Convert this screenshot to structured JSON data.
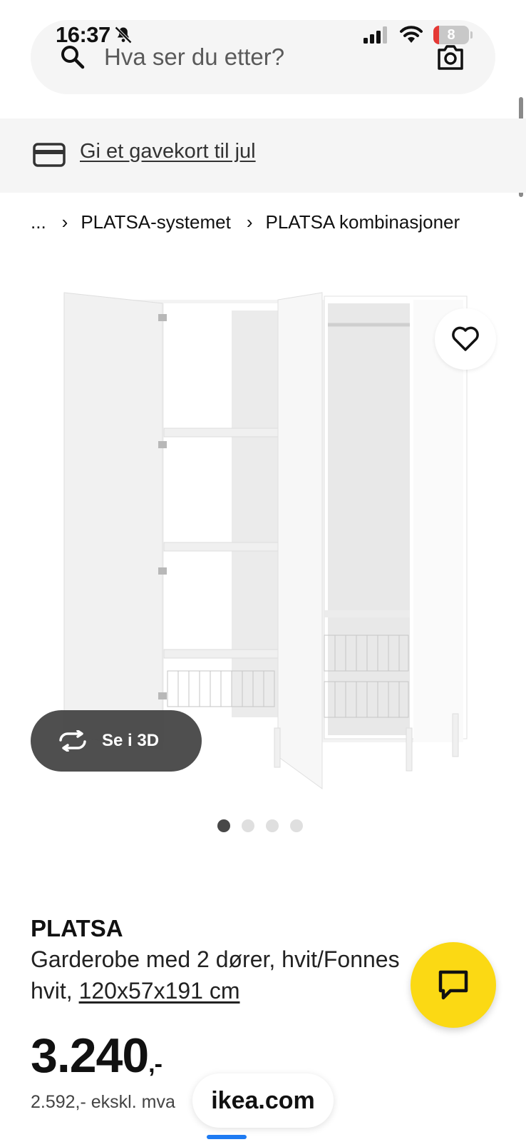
{
  "status_bar": {
    "time": "16:37",
    "battery": "8",
    "icons": [
      "bell-slash-icon",
      "signal-icon",
      "wifi-icon",
      "battery-icon"
    ]
  },
  "search": {
    "placeholder": "Hva ser du etter?",
    "icons": [
      "search-icon",
      "camera-icon"
    ]
  },
  "banner": {
    "link_text": "Gi et gavekort til jul",
    "icon": "card-icon"
  },
  "breadcrumb": {
    "items": [
      "...",
      "PLATSA-systemet",
      "PLATSA kombinasjoner"
    ]
  },
  "gallery": {
    "view_3d_label": "Se i 3D",
    "image_count": 4,
    "active_index": 0
  },
  "product": {
    "name": "PLATSA",
    "description": "Garderobe med 2 dører, hvit/Fonnes hvit, ",
    "dimensions": "120x57x191 cm",
    "price": "3.240",
    "price_suffix": ",-",
    "price_ex_vat": "2.592,- ekskl. mva"
  },
  "browser": {
    "url": "ikea.com"
  },
  "colors": {
    "accent_yellow": "#fbd914",
    "banner_bg": "#f5f5f5",
    "progress_blue": "#1e7bf2"
  }
}
